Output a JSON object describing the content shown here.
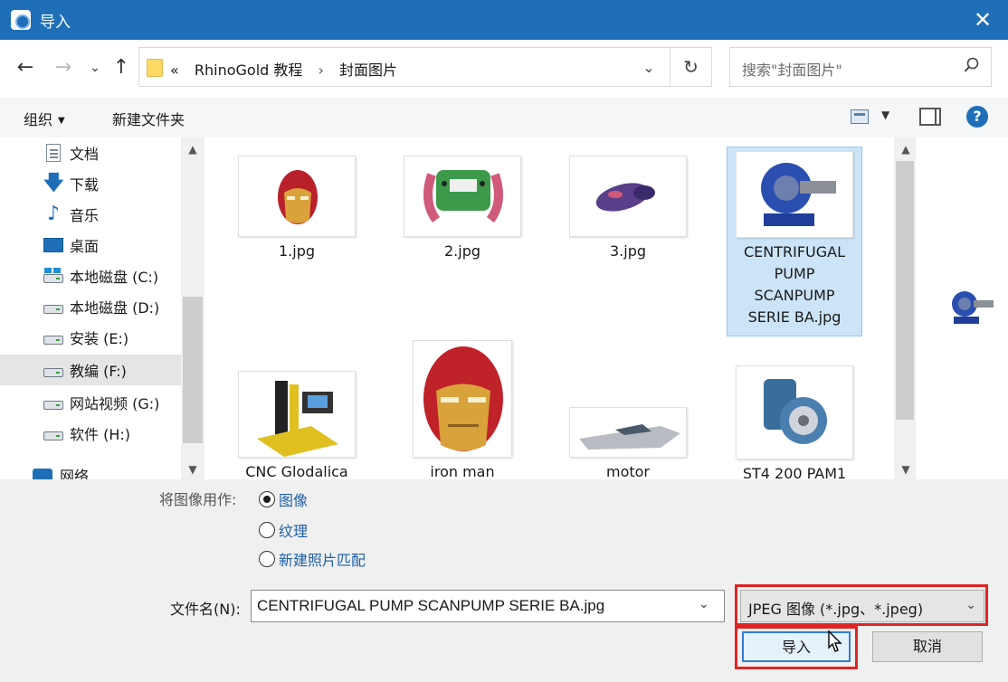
{
  "window": {
    "title": "导入",
    "close_glyph": "✕"
  },
  "nav": {
    "back": "←",
    "forward": "→",
    "recent": "⌄",
    "up": "↑"
  },
  "address": {
    "overflow": "«",
    "crumbs": [
      "RhinoGold 教程",
      "封面图片"
    ],
    "separator": "›",
    "dropdown_glyph": "⌄",
    "refresh_glyph": "↻"
  },
  "search": {
    "placeholder": "搜索\"封面图片\"",
    "icon": "search-icon"
  },
  "toolbar": {
    "organize_label": "组织",
    "new_folder_label": "新建文件夹",
    "help_glyph": "?"
  },
  "sidebar": {
    "items": [
      {
        "label": "文档",
        "icon": "document-icon"
      },
      {
        "label": "下载",
        "icon": "download-icon"
      },
      {
        "label": "音乐",
        "icon": "music-icon"
      },
      {
        "label": "桌面",
        "icon": "desktop-icon"
      },
      {
        "label": "本地磁盘 (C:)",
        "icon": "system-drive-icon"
      },
      {
        "label": "本地磁盘 (D:)",
        "icon": "drive-icon"
      },
      {
        "label": "安装 (E:)",
        "icon": "drive-icon"
      },
      {
        "label": "教编 (F:)",
        "icon": "drive-icon",
        "selected": true
      },
      {
        "label": "网站视频 (G:)",
        "icon": "drive-icon"
      },
      {
        "label": "软件 (H:)",
        "icon": "drive-icon"
      },
      {
        "label": "网络",
        "icon": "network-icon"
      }
    ]
  },
  "files": [
    {
      "name": "1.jpg",
      "subject": "iron man helmet"
    },
    {
      "name": "2.jpg",
      "subject": "steering wheel"
    },
    {
      "name": "3.jpg",
      "subject": "computer mouse"
    },
    {
      "name": "CENTRIFUGAL PUMP SCANPUMP SERIE BA.jpg",
      "subject": "blue pump",
      "selected": true
    },
    {
      "name": "CNC Glodalica",
      "subject": "cnc machine"
    },
    {
      "name": "iron man",
      "subject": "iron man helmet"
    },
    {
      "name": "motor",
      "subject": "boat"
    },
    {
      "name": "ST4 200 PAM1",
      "subject": "gear motor"
    }
  ],
  "use_as": {
    "label": "将图像用作:",
    "options": [
      {
        "label": "图像",
        "checked": true
      },
      {
        "label": "纹理",
        "checked": false
      },
      {
        "label": "新建照片匹配",
        "checked": false
      }
    ]
  },
  "filename": {
    "label": "文件名(N):",
    "value": "CENTRIFUGAL PUMP SCANPUMP SERIE BA.jpg"
  },
  "filetype": {
    "value": "JPEG 图像 (*.jpg、*.jpeg)"
  },
  "buttons": {
    "import": "导入",
    "cancel": "取消"
  },
  "colors": {
    "titlebar": "#1f6fb8",
    "highlight": "#e02424",
    "selection": "#cce4f7"
  }
}
